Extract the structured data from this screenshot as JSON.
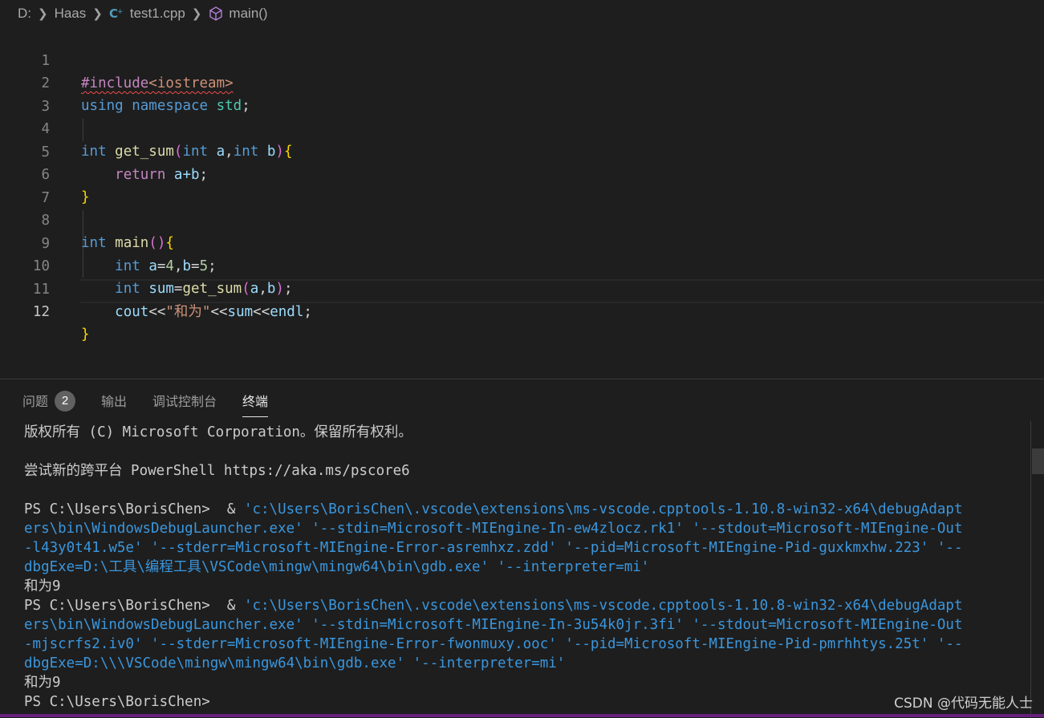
{
  "breadcrumb": {
    "drive": "D:",
    "folder": "Haas",
    "file": "test1.cpp",
    "symbol": "main()"
  },
  "editor": {
    "active_line": "12",
    "lines": [
      {
        "num": "1"
      },
      {
        "num": "2"
      },
      {
        "num": "3"
      },
      {
        "num": "4"
      },
      {
        "num": "5"
      },
      {
        "num": "6"
      },
      {
        "num": "7"
      },
      {
        "num": "8"
      },
      {
        "num": "9"
      },
      {
        "num": "10"
      },
      {
        "num": "11"
      },
      {
        "num": "12"
      }
    ],
    "code": {
      "l1_directive": "#include",
      "l1_header": "<iostream>",
      "l2_using": "using",
      "l2_namespace": "namespace",
      "l2_std": "std",
      "l2_semi": ";",
      "int": "int",
      "l4_fn": "get_sum",
      "l4_a": "a",
      "l4_b": "b",
      "l5_return": "return",
      "l5_expr": "a+b",
      "l8_fn": "main",
      "l9_a": "a",
      "l9_a_val": "4",
      "l9_b": "b",
      "l9_b_val": "5",
      "l10_sum": "sum",
      "l10_call": "get_sum",
      "l10_a": "a",
      "l10_b": "b",
      "l11_cout": "cout",
      "l11_op": "<<",
      "l11_str": "\"和为\"",
      "l11_sum": "sum",
      "l11_endl": "endl"
    }
  },
  "panel": {
    "tabs": [
      {
        "label": "问题",
        "badge": "2"
      },
      {
        "label": "输出"
      },
      {
        "label": "调试控制台"
      },
      {
        "label": "终端"
      }
    ],
    "terminal": {
      "copyright": "版权所有 (C) Microsoft Corporation。保留所有权利。",
      "pscore": "尝试新的跨平台 PowerShell https://aka.ms/pscore6",
      "prompt1": "PS C:\\Users\\BorisChen>  & ",
      "cmd1_l1": "'c:\\Users\\BorisChen\\.vscode\\extensions\\ms-vscode.cpptools-1.10.8-win32-x64\\debugAdapt",
      "cmd1_l2": "ers\\bin\\WindowsDebugLauncher.exe' '--stdin=Microsoft-MIEngine-In-ew4zlocz.rk1' '--stdout=Microsoft-MIEngine-Out",
      "cmd1_l3": "-l43y0t41.w5e' '--stderr=Microsoft-MIEngine-Error-asremhxz.zdd' '--pid=Microsoft-MIEngine-Pid-guxkmxhw.223' '--",
      "cmd1_l4": "dbgExe=D:\\工具\\编程工具\\VSCode\\mingw\\mingw64\\bin\\gdb.exe' '--interpreter=mi'",
      "out1": "和为9",
      "prompt2": "PS C:\\Users\\BorisChen>  & ",
      "cmd2_l1": "'c:\\Users\\BorisChen\\.vscode\\extensions\\ms-vscode.cpptools-1.10.8-win32-x64\\debugAdapt",
      "cmd2_l2": "ers\\bin\\WindowsDebugLauncher.exe' '--stdin=Microsoft-MIEngine-In-3u54k0jr.3fi' '--stdout=Microsoft-MIEngine-Out",
      "cmd2_l3": "-mjscrfs2.iv0' '--stderr=Microsoft-MIEngine-Error-fwonmuxy.ooc' '--pid=Microsoft-MIEngine-Pid-pmrhhtys.25t' '--",
      "cmd2_l4": "dbgExe=D:\\\\\\VSCode\\mingw\\mingw64\\bin\\gdb.exe' '--interpreter=mi'",
      "out2": "和为9",
      "prompt3": "PS C:\\Users\\BorisChen>"
    }
  },
  "watermark": "CSDN @代码无能人士"
}
